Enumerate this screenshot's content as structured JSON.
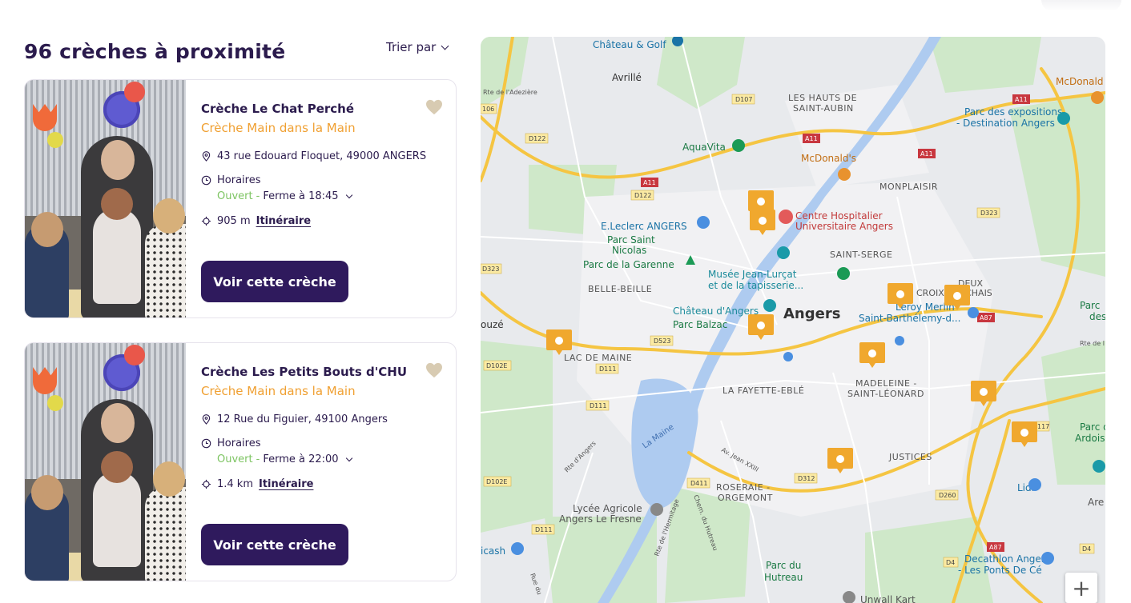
{
  "list": {
    "title": "96 crèches à proximité",
    "sort_label": "Trier par"
  },
  "cards": [
    {
      "name": "Crèche Le Chat Perché",
      "network": "Crèche Main dans la Main",
      "address": "43 rue Edouard Floquet, 49000 ANGERS",
      "hours_label": "Horaires",
      "status": "Ouvert",
      "closing": "Ferme à 18:45",
      "distance": "905 m",
      "itinerary": "Itinéraire",
      "button": "Voir cette crèche"
    },
    {
      "name": "Crèche Les Petits Bouts d'CHU",
      "network": "Crèche Main dans la Main",
      "address": "12 Rue du Figuier, 49100 Angers",
      "hours_label": "Horaires",
      "status": "Ouvert",
      "closing": "Ferme à 22:00",
      "distance": "1.4 km",
      "itinerary": "Itinéraire",
      "button": "Voir cette crèche"
    }
  ],
  "map": {
    "labels": {
      "chateau_golf": "Château & Golf",
      "avrille": "Avrillé",
      "rte_adezière": "Rte de l'Adezière",
      "hauts1": "LES HAUTS DE",
      "hauts2": "SAINT-AUBIN",
      "mcdonalds_top": "McDonald",
      "parc_expo1": "Parc des expositions",
      "parc_expo2": "- Destination Angers",
      "aquavita": "AquaVita",
      "mcdonalds": "McDonald's",
      "monplaisir": "MONPLAISIR",
      "leclerc": "E.Leclerc ANGERS",
      "parc_st1": "Parc Saint",
      "parc_st2": "Nicolas",
      "garenne": "Parc de la Garenne",
      "chu1": "Centre Hospitalier",
      "chu2": "Universitaire Angers",
      "saint_serge": "SAINT-SERGE",
      "musee1": "Musée Jean-Lurçat",
      "musee2": "et de la tapisserie...",
      "belle_beille": "BELLE-BEILLE",
      "deux1": "DEUX",
      "deux2": "CROIX-BANCHAIS",
      "chateau_angers": "Château d'Angers",
      "angers": "Angers",
      "leroy": "Leroy Merlin",
      "st_barth": "Saint-Barthélemy-d...",
      "parc_balzac": "Parc Balzac",
      "ouze": "ouzé",
      "lac_maine": "LAC DE MAINE",
      "madeleine1": "MADELEINE -",
      "madeleine2": "SAINT-LÉONARD",
      "fayette": "LA FAYETTE-EBLÉ",
      "la_maine": "La Maine",
      "parc_ardoisieres1": "Parc des",
      "parc_ardoisieres2": "Ardoisi",
      "justices": "JUSTICES",
      "roseraie1": "ROSERAIE -",
      "roseraie2": "ORGEMONT",
      "lidl": "Lidl",
      "lycee1": "Lycée Agricole",
      "lycee2": "Angers Le Fresne",
      "parc_hut1": "Parc du",
      "parc_hut2": "Hutreau",
      "decathlon1": "Decathlon Angers",
      "decathlon2": "- Les Ponts De Cé",
      "icash": "icash",
      "unwall": "Unwall Kart",
      "rte_angers": "Rte d'Angers",
      "av_jean": "Av. Jean XXIII",
      "rte_hermitage": "Rte de l'Hermitage",
      "chem_hutreau": "Chem. du Hutreau",
      "rue_du": "Rue du",
      "parc_right1": "Parc",
      "parc_right2": "des",
      "rte_right": "Rte de l",
      "are": "Are",
      "d107": "D107",
      "d122a": "D122",
      "d122b": "D122",
      "a11a": "A11",
      "a11b": "A11",
      "a11c": "A11",
      "a11d": "A11",
      "d323a": "D323",
      "d323b": "D323",
      "d523": "D523",
      "d111a": "D111",
      "d111b": "D111",
      "d111c": "D111",
      "d102ea": "D102E",
      "d102eb": "D102E",
      "d411": "D411",
      "d312": "D312",
      "d260": "D260",
      "a87a": "A87",
      "a87b": "A87",
      "d4a": "D4",
      "d4b": "D4",
      "n106": "106",
      "d117": "117"
    },
    "zoom_label": "+"
  }
}
